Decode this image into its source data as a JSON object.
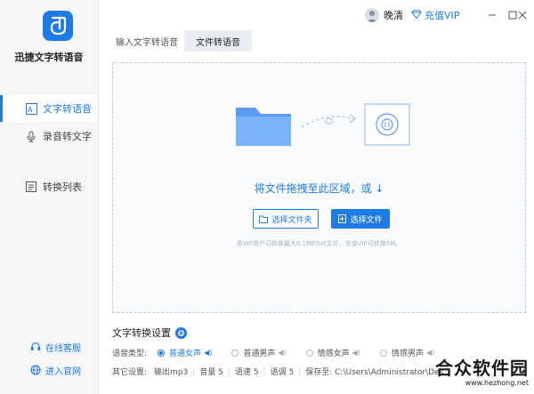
{
  "app": {
    "name": "迅捷文字转语音"
  },
  "sidebar": {
    "items": [
      {
        "label": "文字转语音",
        "active": true,
        "icon": "text-to-speech-icon"
      },
      {
        "label": "录音转文字",
        "active": false,
        "icon": "microphone-icon"
      },
      {
        "label": "转换列表",
        "active": false,
        "icon": "list-icon"
      }
    ],
    "footer": [
      {
        "label": "在线客服",
        "icon": "customer-service-icon"
      },
      {
        "label": "进入官网",
        "icon": "globe-icon"
      }
    ]
  },
  "titlebar": {
    "username": "晚清",
    "vip_label": "充值VIP"
  },
  "tabs": [
    {
      "label": "输入文字转语音",
      "active": false
    },
    {
      "label": "文件转语音",
      "active": true
    }
  ],
  "dropzone": {
    "hint": "将文件拖拽至此区域，或 ↓",
    "select_folder": "选择文件夹",
    "select_file": "选择文件",
    "note": "非VIP用户可转换最大0.1M的txt文件，充值VIP可转换5M。"
  },
  "settings": {
    "title": "文字转换设置",
    "voice_label": "语音类型:",
    "voices": [
      {
        "label": "普通女声",
        "selected": true
      },
      {
        "label": "普通男声",
        "selected": false
      },
      {
        "label": "情感女声",
        "selected": false
      },
      {
        "label": "情感男声",
        "selected": false
      }
    ],
    "other_label": "其它设置:",
    "output": "输出mp3",
    "volume": "音量 5",
    "speed": "语速 5",
    "pitch": "语调 5",
    "save_to": "保存至: C:\\Users\\Administrator\\Des"
  },
  "watermark": {
    "main": "合众软件园",
    "sub": "www.hezhong.net"
  },
  "colors": {
    "accent": "#1e7be6",
    "sidebar_bg": "#f5f6f8",
    "dropzone_border": "#bcc6d4"
  }
}
